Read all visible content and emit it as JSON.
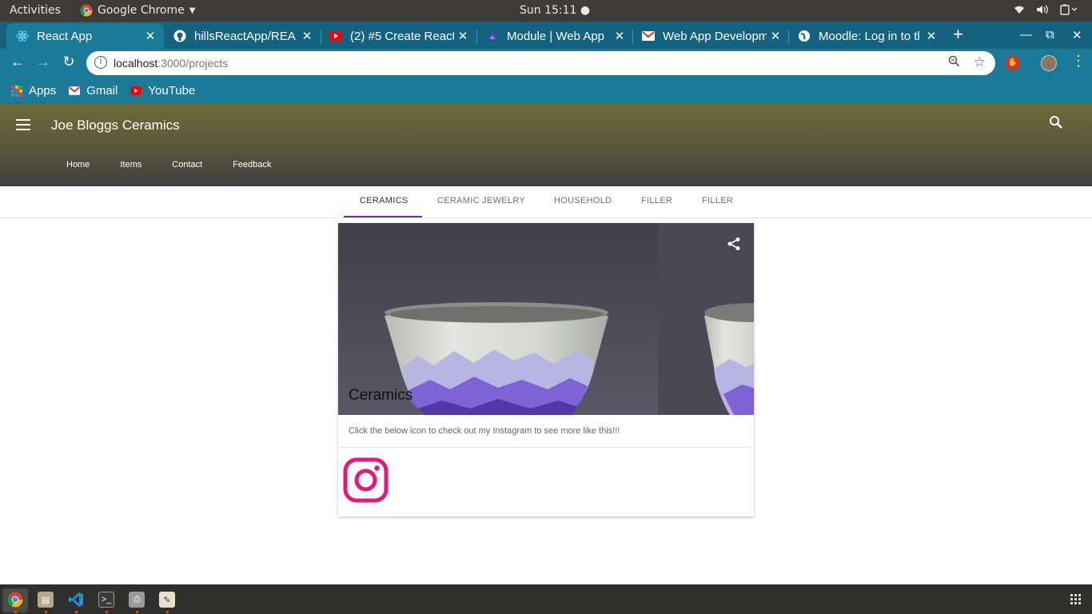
{
  "system": {
    "activities": "Activities",
    "app_menu": "Google Chrome",
    "clock": "Sun 15:11"
  },
  "browser": {
    "tabs": [
      {
        "title": "React App",
        "icon": "react-icon",
        "active": true
      },
      {
        "title": "hillsReactApp/REA",
        "icon": "github-icon"
      },
      {
        "title": "(2) #5 Create React",
        "icon": "youtube-icon"
      },
      {
        "title": "Module | Web App",
        "icon": "module-icon"
      },
      {
        "title": "Web App Developm",
        "icon": "gmail-icon"
      },
      {
        "title": "Moodle: Log in to tl",
        "icon": "globe-icon"
      }
    ],
    "url_host": "localhost",
    "url_path": ":3000/projects",
    "bookmarks": [
      {
        "label": "Apps",
        "icon": "apps-grid-icon"
      },
      {
        "label": "Gmail",
        "icon": "gmail-icon"
      },
      {
        "label": "YouTube",
        "icon": "youtube-icon"
      }
    ]
  },
  "app": {
    "title": "Joe Bloggs Ceramics",
    "nav": [
      "Home",
      "Items",
      "Contact",
      "Feedback"
    ],
    "category_tabs": [
      "CERAMICS",
      "CERAMIC JEWELRY",
      "HOUSEHOLD",
      "FILLER",
      "FILLER"
    ],
    "active_tab": "CERAMICS",
    "accent": "#6a2bc4",
    "card": {
      "title": "Ceramics",
      "description": "Click the below icon to check out my Instagram to see more like this!!!",
      "link_icon": "instagram-icon",
      "instagram_color": "#e6197a"
    }
  },
  "dock": [
    "chrome-icon",
    "files-icon",
    "vscode-icon",
    "terminal-icon",
    "printer-icon",
    "text-editor-icon"
  ]
}
